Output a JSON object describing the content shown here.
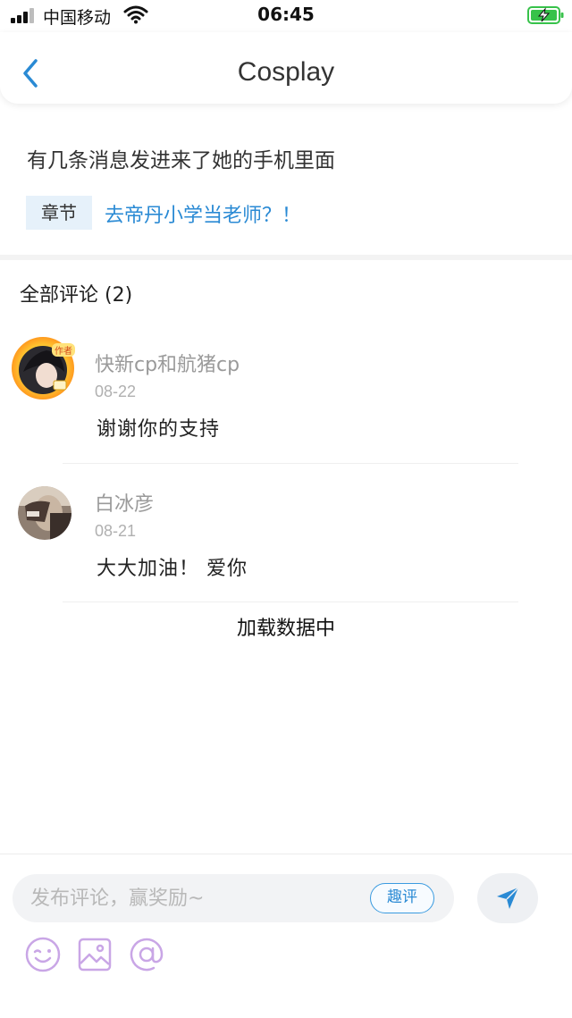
{
  "status_bar": {
    "carrier": "中国移动",
    "time": "06:45"
  },
  "nav": {
    "title": "Cosplay",
    "back_icon": "chevron-left-icon"
  },
  "post": {
    "text": "有几条消息发进来了她的手机里面",
    "chapter_label": "章节",
    "chapter_title": "去帝丹小学当老师？！"
  },
  "comments_section": {
    "header": "全部评论 (2)",
    "items": [
      {
        "name": "快新cp和航猪cp",
        "date": "08-22",
        "text": "谢谢你的支持",
        "badge": "作者"
      },
      {
        "name": "白冰彦",
        "date": "08-21",
        "text": "大大加油！ 爱你"
      }
    ],
    "loading_text": "加载数据中"
  },
  "composer": {
    "placeholder": "发布评论，赢奖励~",
    "quping_label": "趣评",
    "send_icon": "send-icon",
    "tools": [
      "emoji-icon",
      "image-icon",
      "mention-icon"
    ]
  },
  "colors": {
    "accent": "#2a8ad4",
    "tool_icon": "#c9a6e6",
    "battery_green": "#37c24a"
  }
}
